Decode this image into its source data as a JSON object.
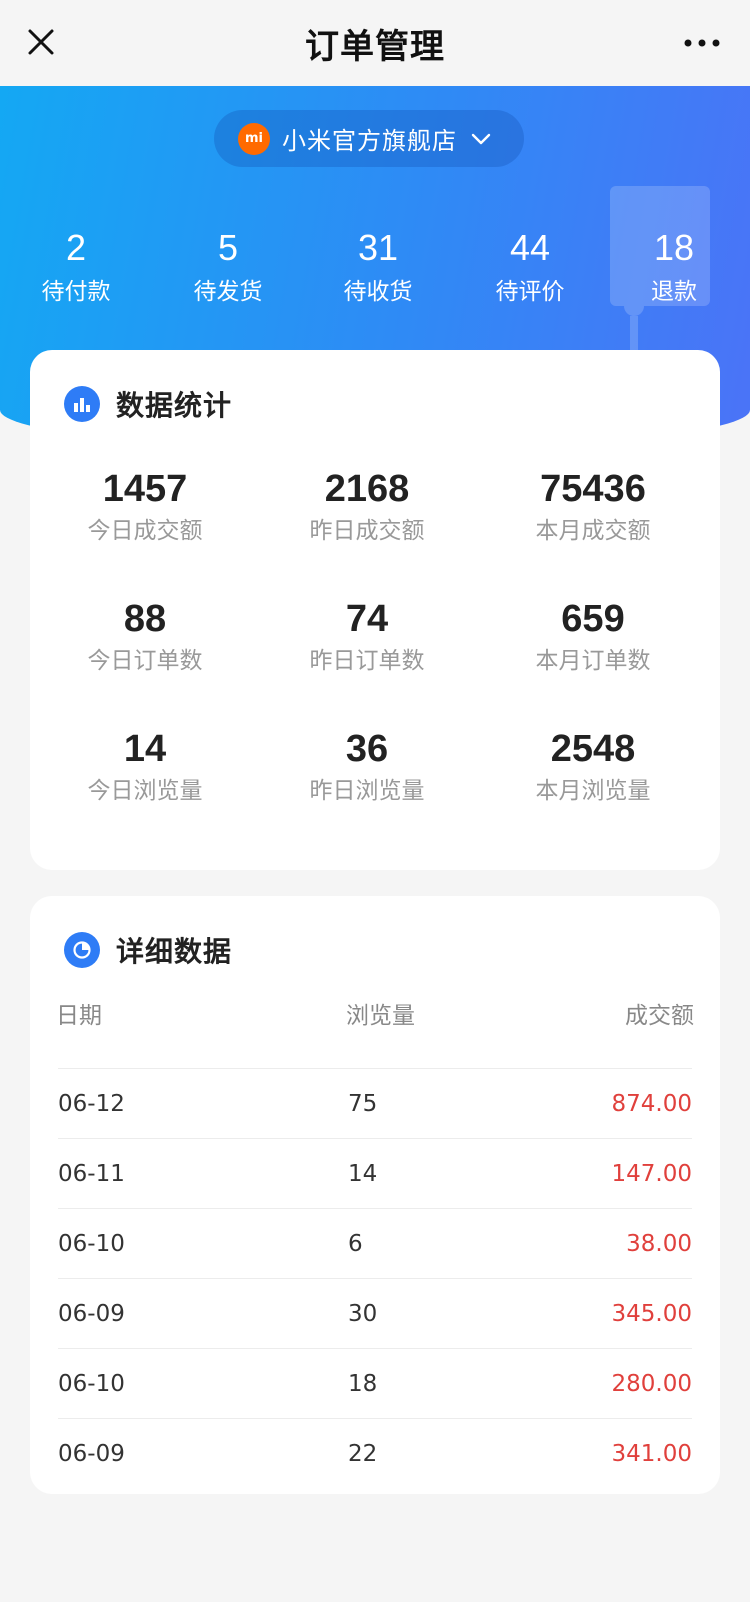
{
  "navbar": {
    "title": "订单管理"
  },
  "store": {
    "logo_text": "mi",
    "name": "小米官方旗舰店"
  },
  "order_status": [
    {
      "count": "2",
      "label": "待付款"
    },
    {
      "count": "5",
      "label": "待发货"
    },
    {
      "count": "31",
      "label": "待收货"
    },
    {
      "count": "44",
      "label": "待评价"
    },
    {
      "count": "18",
      "label": "退款"
    }
  ],
  "stats": {
    "title": "数据统计",
    "items": [
      {
        "value": "1457",
        "label": "今日成交额"
      },
      {
        "value": "2168",
        "label": "昨日成交额"
      },
      {
        "value": "75436",
        "label": "本月成交额"
      },
      {
        "value": "88",
        "label": "今日订单数"
      },
      {
        "value": "74",
        "label": "昨日订单数"
      },
      {
        "value": "659",
        "label": "本月订单数"
      },
      {
        "value": "14",
        "label": "今日浏览量"
      },
      {
        "value": "36",
        "label": "昨日浏览量"
      },
      {
        "value": "2548",
        "label": "本月浏览量"
      }
    ]
  },
  "detail": {
    "title": "详细数据",
    "columns": {
      "date": "日期",
      "views": "浏览量",
      "amount": "成交额"
    },
    "rows": [
      {
        "date": "06-12",
        "views": "75",
        "amount": "874.00"
      },
      {
        "date": "06-11",
        "views": "14",
        "amount": "147.00"
      },
      {
        "date": "06-10",
        "views": "6",
        "amount": "38.00"
      },
      {
        "date": "06-09",
        "views": "30",
        "amount": "345.00"
      },
      {
        "date": "06-10",
        "views": "18",
        "amount": "280.00"
      },
      {
        "date": "06-09",
        "views": "22",
        "amount": "341.00"
      }
    ]
  },
  "colors": {
    "accent": "#2e7cf6",
    "amount": "#e0403c",
    "header_start": "#14a8f3",
    "header_end": "#4b73f7"
  }
}
